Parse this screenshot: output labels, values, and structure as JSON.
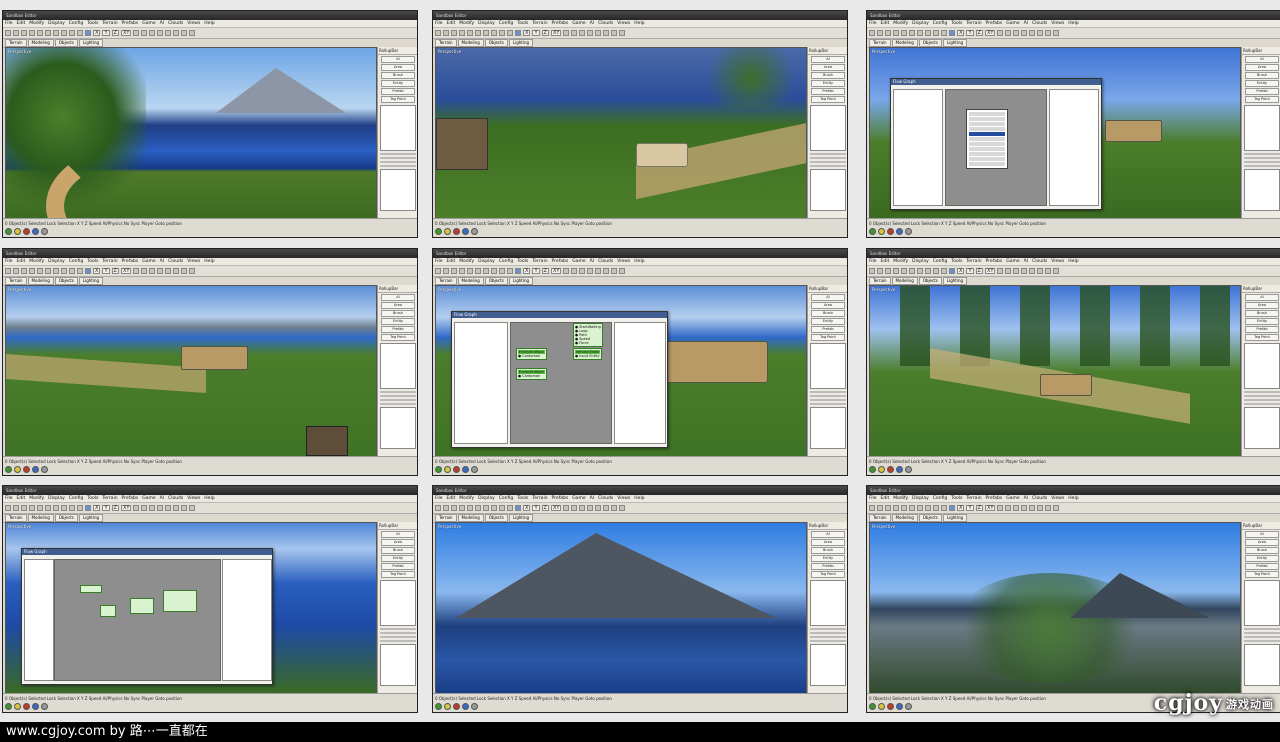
{
  "editor": {
    "title": "Sandbox Editor",
    "menu": [
      "File",
      "Edit",
      "Modify",
      "Display",
      "Config",
      "Tools",
      "Terrain",
      "Prefabs",
      "Game",
      "AI",
      "Clouds",
      "Views",
      "Help"
    ],
    "axes": [
      "X",
      "Y",
      "Z",
      "XY"
    ],
    "tabs": [
      "Terrain",
      "Modeling",
      "Objects",
      "Lighting"
    ],
    "viewport_label": "Perspective",
    "rollup_title": "RollupBar",
    "rollup_buttons": [
      "AI",
      "Area",
      "Brush",
      "Entity",
      "Prefab",
      "Tag Point"
    ],
    "status_text": "0 Object(s) Selected   Lock Selection   X   Y   Z   Speed   AI/Physics   No Sync Player   Goto position",
    "flowgraph_title": "Flow Graph"
  },
  "panels": [
    {
      "scene": "lake-road",
      "overlay": "none"
    },
    {
      "scene": "humvee-grass",
      "overlay": "none"
    },
    {
      "scene": "tank-dialog",
      "overlay": "context-menu"
    },
    {
      "scene": "tank-plain",
      "overlay": "none"
    },
    {
      "scene": "tank-flowgraph",
      "overlay": "flowgraph-nodes"
    },
    {
      "scene": "tank-trees",
      "overlay": "none"
    },
    {
      "scene": "flowgraph-small",
      "overlay": "flowgraph-small"
    },
    {
      "scene": "mountain-sea",
      "overlay": "none"
    },
    {
      "scene": "blurred-tree",
      "overlay": "none"
    }
  ],
  "flowgraph_nodes": [
    {
      "header": "Entity:EntityId",
      "rows": [
        "Cardoman"
      ]
    },
    {
      "header": "Entity:EntityId",
      "rows": [
        "Cardoman"
      ]
    },
    {
      "header": "Vehicle:Enter",
      "rows": [
        "Input Entity"
      ]
    },
    {
      "header": "",
      "rows": [
        "StartWaiting",
        "Loop",
        "Path",
        "Speed",
        "Force"
      ]
    }
  ],
  "footer": {
    "text": "www.cgjoy.com by 路⋯一直都在",
    "logo": "cgjoy",
    "logo_cn": "游戏动画"
  }
}
